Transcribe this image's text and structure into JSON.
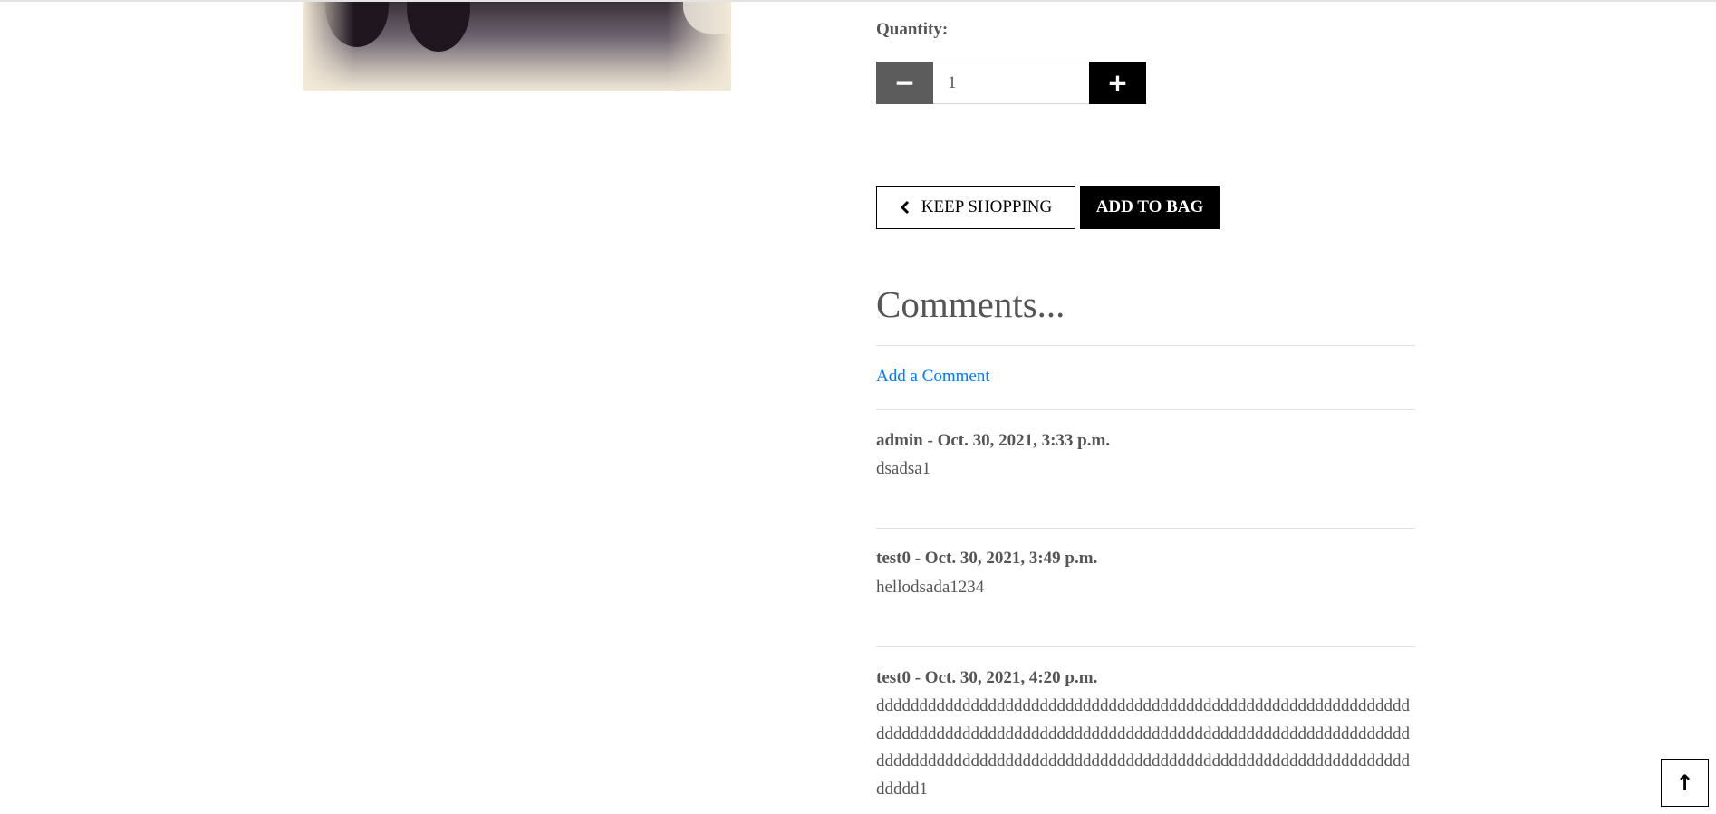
{
  "product": {
    "image_alt": "dumbbells and sneaker on gym floor"
  },
  "quantity": {
    "label": "Quantity:",
    "value": "1",
    "minus_icon": "minus-icon",
    "plus_icon": "plus-icon"
  },
  "actions": {
    "keep_shopping": "KEEP SHOPPING",
    "keep_icon": "chevron-left-icon",
    "add_to_bag": "ADD TO BAG"
  },
  "comments": {
    "heading": "Comments...",
    "add_link": "Add a Comment",
    "items": [
      {
        "header": "admin - Oct. 30, 2021, 3:33 p.m.",
        "body": "dsadsa1"
      },
      {
        "header": "test0 - Oct. 30, 2021, 3:49 p.m.",
        "body": "hellodsada1234"
      },
      {
        "header": "test0 - Oct. 30, 2021, 4:20 p.m.",
        "body": "ddddddddddddddddddddddddddddddddddddddddddddddddddddddddddddddddddddddddddddddddddddddddddddddddddddddddddddddddddddddddddddddddddddddddddddddddddddddddddddddddddddddddddddddddddddddddddddddd1"
      }
    ]
  },
  "scroll_top": {
    "icon": "arrow-up-icon",
    "glyph": "↑"
  },
  "colors": {
    "link": "#007bff",
    "text": "#555555",
    "button_dark": "#000000",
    "minus_bg": "#5c5c5c"
  }
}
